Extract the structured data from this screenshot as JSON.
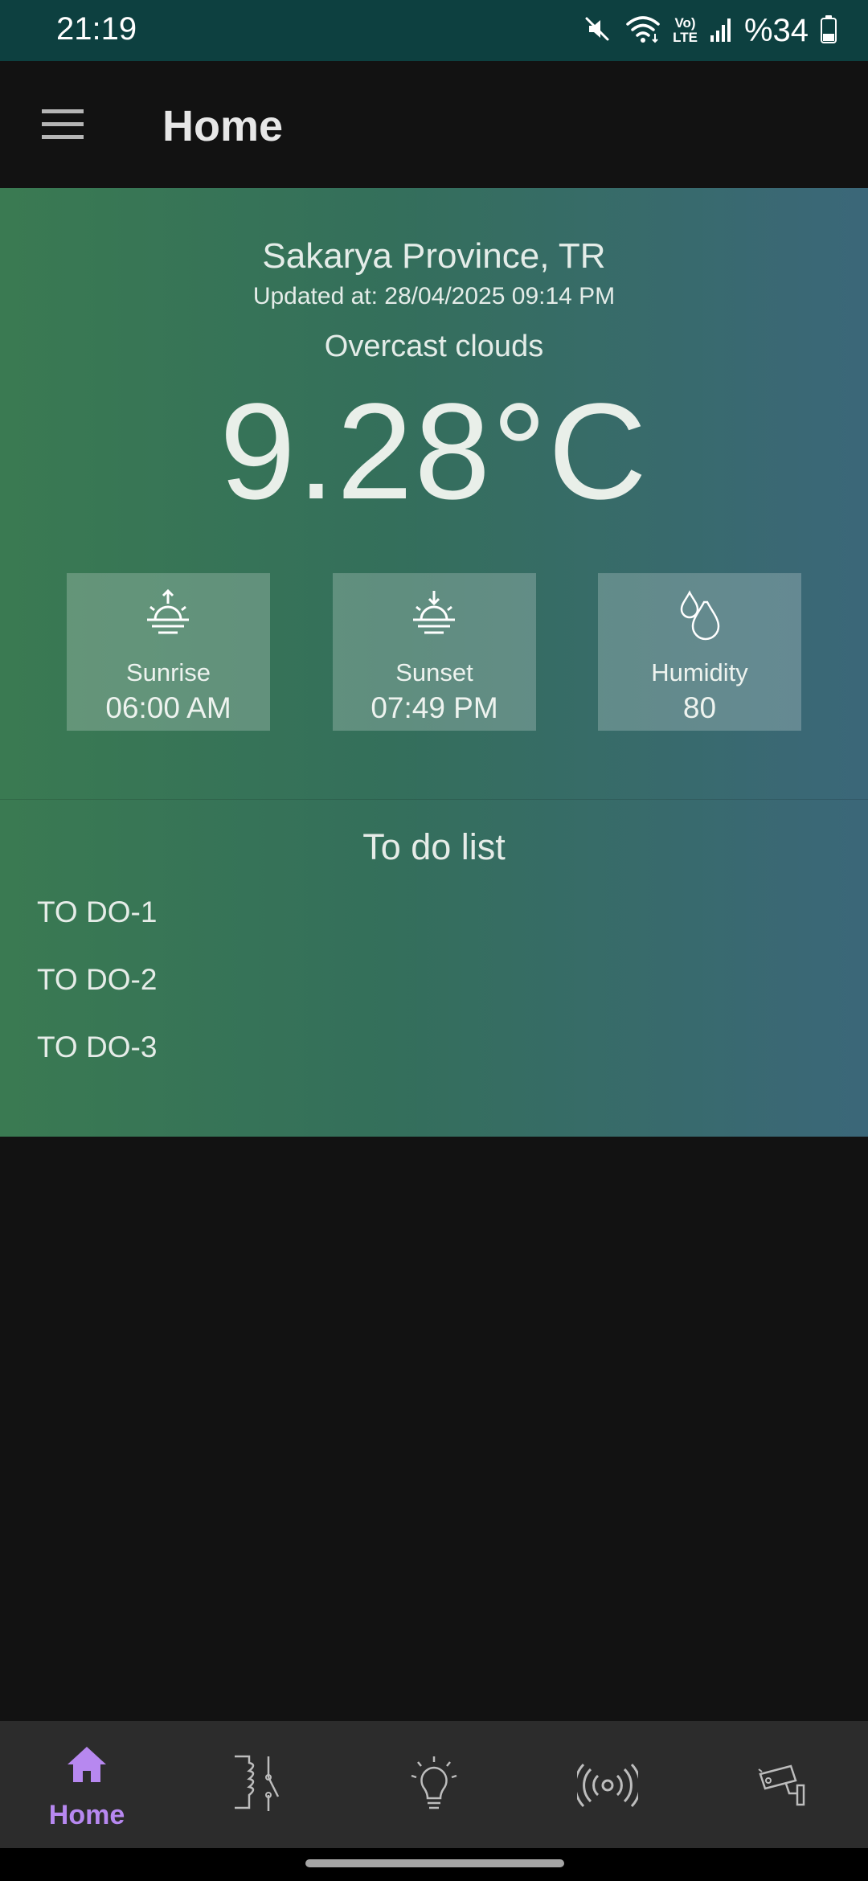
{
  "status_bar": {
    "time": "21:19",
    "battery": "%34",
    "volte_label_top": "Vo)",
    "volte_label_bottom": "LTE",
    "icons": [
      "mute-icon",
      "wifi-icon",
      "volte-icon",
      "signal-icon",
      "battery-icon"
    ]
  },
  "app_bar": {
    "title": "Home",
    "menu_icon": "hamburger-icon"
  },
  "weather": {
    "location": "Sakarya Province, TR",
    "updated": "Updated at: 28/04/2025 09:14 PM",
    "description": "Overcast clouds",
    "temperature": "9.28°C",
    "cards": [
      {
        "label": "Sunrise",
        "value": "06:00 AM",
        "icon": "sunrise-icon"
      },
      {
        "label": "Sunset",
        "value": "07:49 PM",
        "icon": "sunset-icon"
      },
      {
        "label": "Humidity",
        "value": "80",
        "icon": "humidity-icon"
      }
    ]
  },
  "todo": {
    "title": "To do list",
    "items": [
      "TO DO-1",
      "TO DO-2",
      "TO DO-3"
    ]
  },
  "bottom_nav": {
    "items": [
      {
        "label": "Home",
        "icon": "home-icon",
        "active": true
      },
      {
        "label": "",
        "icon": "relay-icon"
      },
      {
        "label": "",
        "icon": "lightbulb-icon"
      },
      {
        "label": "",
        "icon": "broadcast-icon"
      },
      {
        "label": "",
        "icon": "security-camera-icon"
      }
    ]
  },
  "colors": {
    "status_bar": "#0d4040",
    "background": "#121212",
    "gradient_left": "#3a7a52",
    "gradient_right": "#3b6779",
    "accent": "#b788f0",
    "nav_background": "#2c2c2c"
  }
}
